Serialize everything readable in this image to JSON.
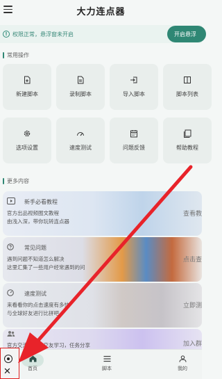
{
  "header": {
    "title": "大力连点器",
    "menu_icon": "hamburger-menu-icon"
  },
  "permission_bar": {
    "text": "权限正常，悬浮窗未开启",
    "button_label": "开启悬浮"
  },
  "sections": {
    "common": "常用操作",
    "more": "更多内容"
  },
  "tiles": [
    {
      "label": "新建脚本",
      "icon": "new-file-icon"
    },
    {
      "label": "录制脚本",
      "icon": "record-file-icon"
    },
    {
      "label": "导入脚本",
      "icon": "import-icon"
    },
    {
      "label": "脚本列表",
      "icon": "list-icon"
    },
    {
      "label": "选项设置",
      "icon": "gear-icon"
    },
    {
      "label": "速度测试",
      "icon": "speedometer-icon"
    },
    {
      "label": "问题反馈",
      "icon": "calendar-icon"
    },
    {
      "label": "帮助教程",
      "icon": "book-icon"
    }
  ],
  "cards": [
    {
      "title": "新手必看教程",
      "desc1": "官方出品视频图文教程",
      "desc2": "由浅入深，带你玩转连点器",
      "action": "查看教",
      "icon": "play-icon"
    },
    {
      "title": "常见问题",
      "desc1": "遇到问题不知道怎么解决",
      "desc2": "这里汇集了一些用户经常遇到的问",
      "action": "点击查",
      "icon": "help-circle-icon"
    },
    {
      "title": "速度测试",
      "desc1": "来看看你的点击速度有多快",
      "desc2": "与全球好友进行比拼吧",
      "action": "立即测",
      "icon": "speedometer-icon"
    },
    {
      "title": "",
      "desc1": "官方交流互助，交友学习，任务分享",
      "desc2": "",
      "action": "加入群",
      "icon": "users-icon"
    }
  ],
  "bottom_nav": [
    {
      "label": "首页",
      "icon": "home-icon"
    },
    {
      "label": "脚本",
      "icon": "list-icon"
    },
    {
      "label": "我的",
      "icon": "user-icon"
    }
  ],
  "floating_widget": {
    "record_icon": "record-icon",
    "close_icon": "close-icon",
    "highlight_color": "#e02020"
  },
  "accent_color": "#2f8774",
  "annotation_arrow_color": "#e8232a"
}
